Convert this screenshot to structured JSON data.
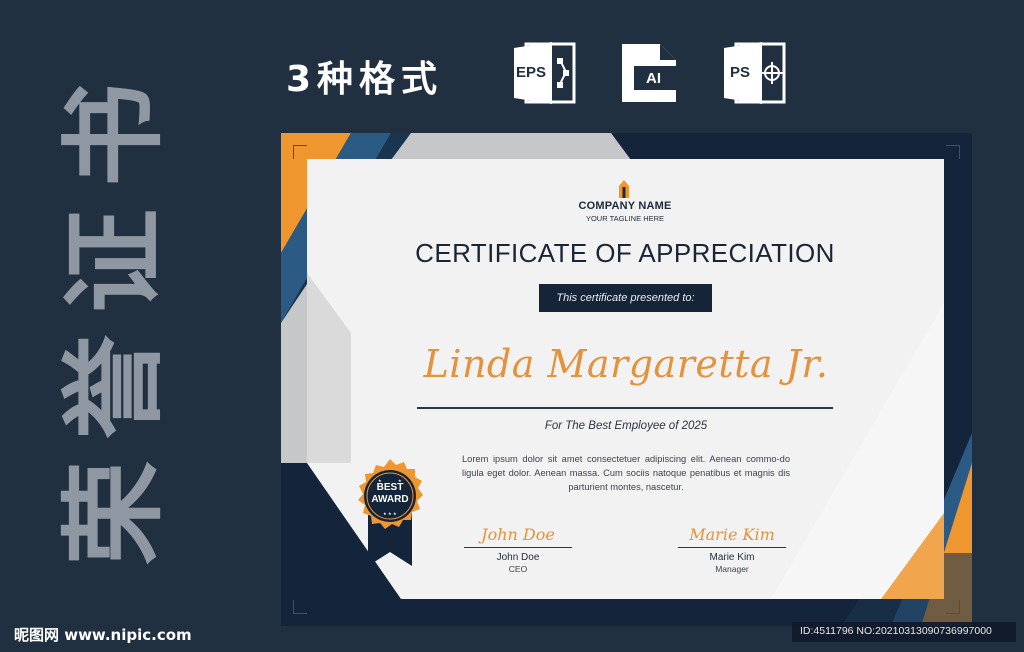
{
  "vertical_title": [
    "荣",
    "誉",
    "证",
    "书"
  ],
  "header": {
    "formats_label": "3种格式",
    "format_icons": [
      {
        "name": "eps-file-icon",
        "label": "EPS"
      },
      {
        "name": "ai-file-icon",
        "label": "AI"
      },
      {
        "name": "ps-file-icon",
        "label": "PS"
      }
    ]
  },
  "certificate": {
    "company_name": "COMPANY NAME",
    "tagline": "YOUR TAGLINE HERE",
    "title": "CERTIFICATE OF APPRECIATION",
    "presented_to": "This certificate presented to:",
    "recipient_name": "Linda Margaretta Jr.",
    "subtitle": "For The Best Employee of 2025",
    "body_text": "Lorem ipsum dolor sit amet consectetuer adipiscing elit. Aenean commo-do ligula eget dolor. Aenean massa. Cum sociis natoque penatibus et magnis dis parturient montes, nascetur.",
    "badge": {
      "line1": "BEST",
      "line2": "AWARD"
    },
    "signatures": [
      {
        "script": "John Doe",
        "name": "John Doe",
        "role": "CEO"
      },
      {
        "script": "Marie Kim",
        "name": "Marie Kim",
        "role": "Manager"
      }
    ],
    "colors": {
      "navy": "#14243a",
      "orange": "#f0962f",
      "blue": "#2b5a85",
      "paper": "#f2f2f2"
    }
  },
  "footer": {
    "watermark": "昵图网 www.nipic.com",
    "id_text": "ID:4511796 NO:20210313090736997000"
  }
}
